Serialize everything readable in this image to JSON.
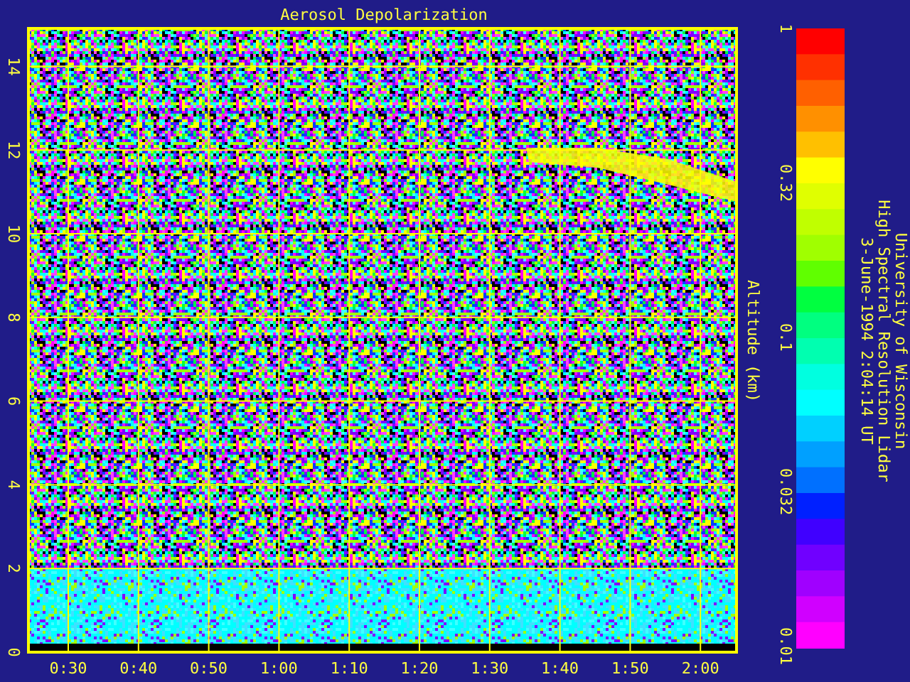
{
  "title": "Aerosol Depolarization",
  "y_axis": {
    "label": "Altitude (km)",
    "ticks": [
      "0",
      "2",
      "4",
      "6",
      "8",
      "10",
      "12",
      "14"
    ]
  },
  "x_axis": {
    "ticks": [
      "0:30",
      "0:40",
      "0:50",
      "1:00",
      "1:10",
      "1:20",
      "1:30",
      "1:40",
      "1:50",
      "2:00"
    ]
  },
  "color_bar": {
    "ticks": [
      "1",
      "0.32",
      "0.1",
      "0.032",
      "0.01"
    ]
  },
  "caption": [
    "University of Wisconsin",
    "High Spectral Resolution Lidar",
    "3-June-1994  2:04:14 UT"
  ]
}
